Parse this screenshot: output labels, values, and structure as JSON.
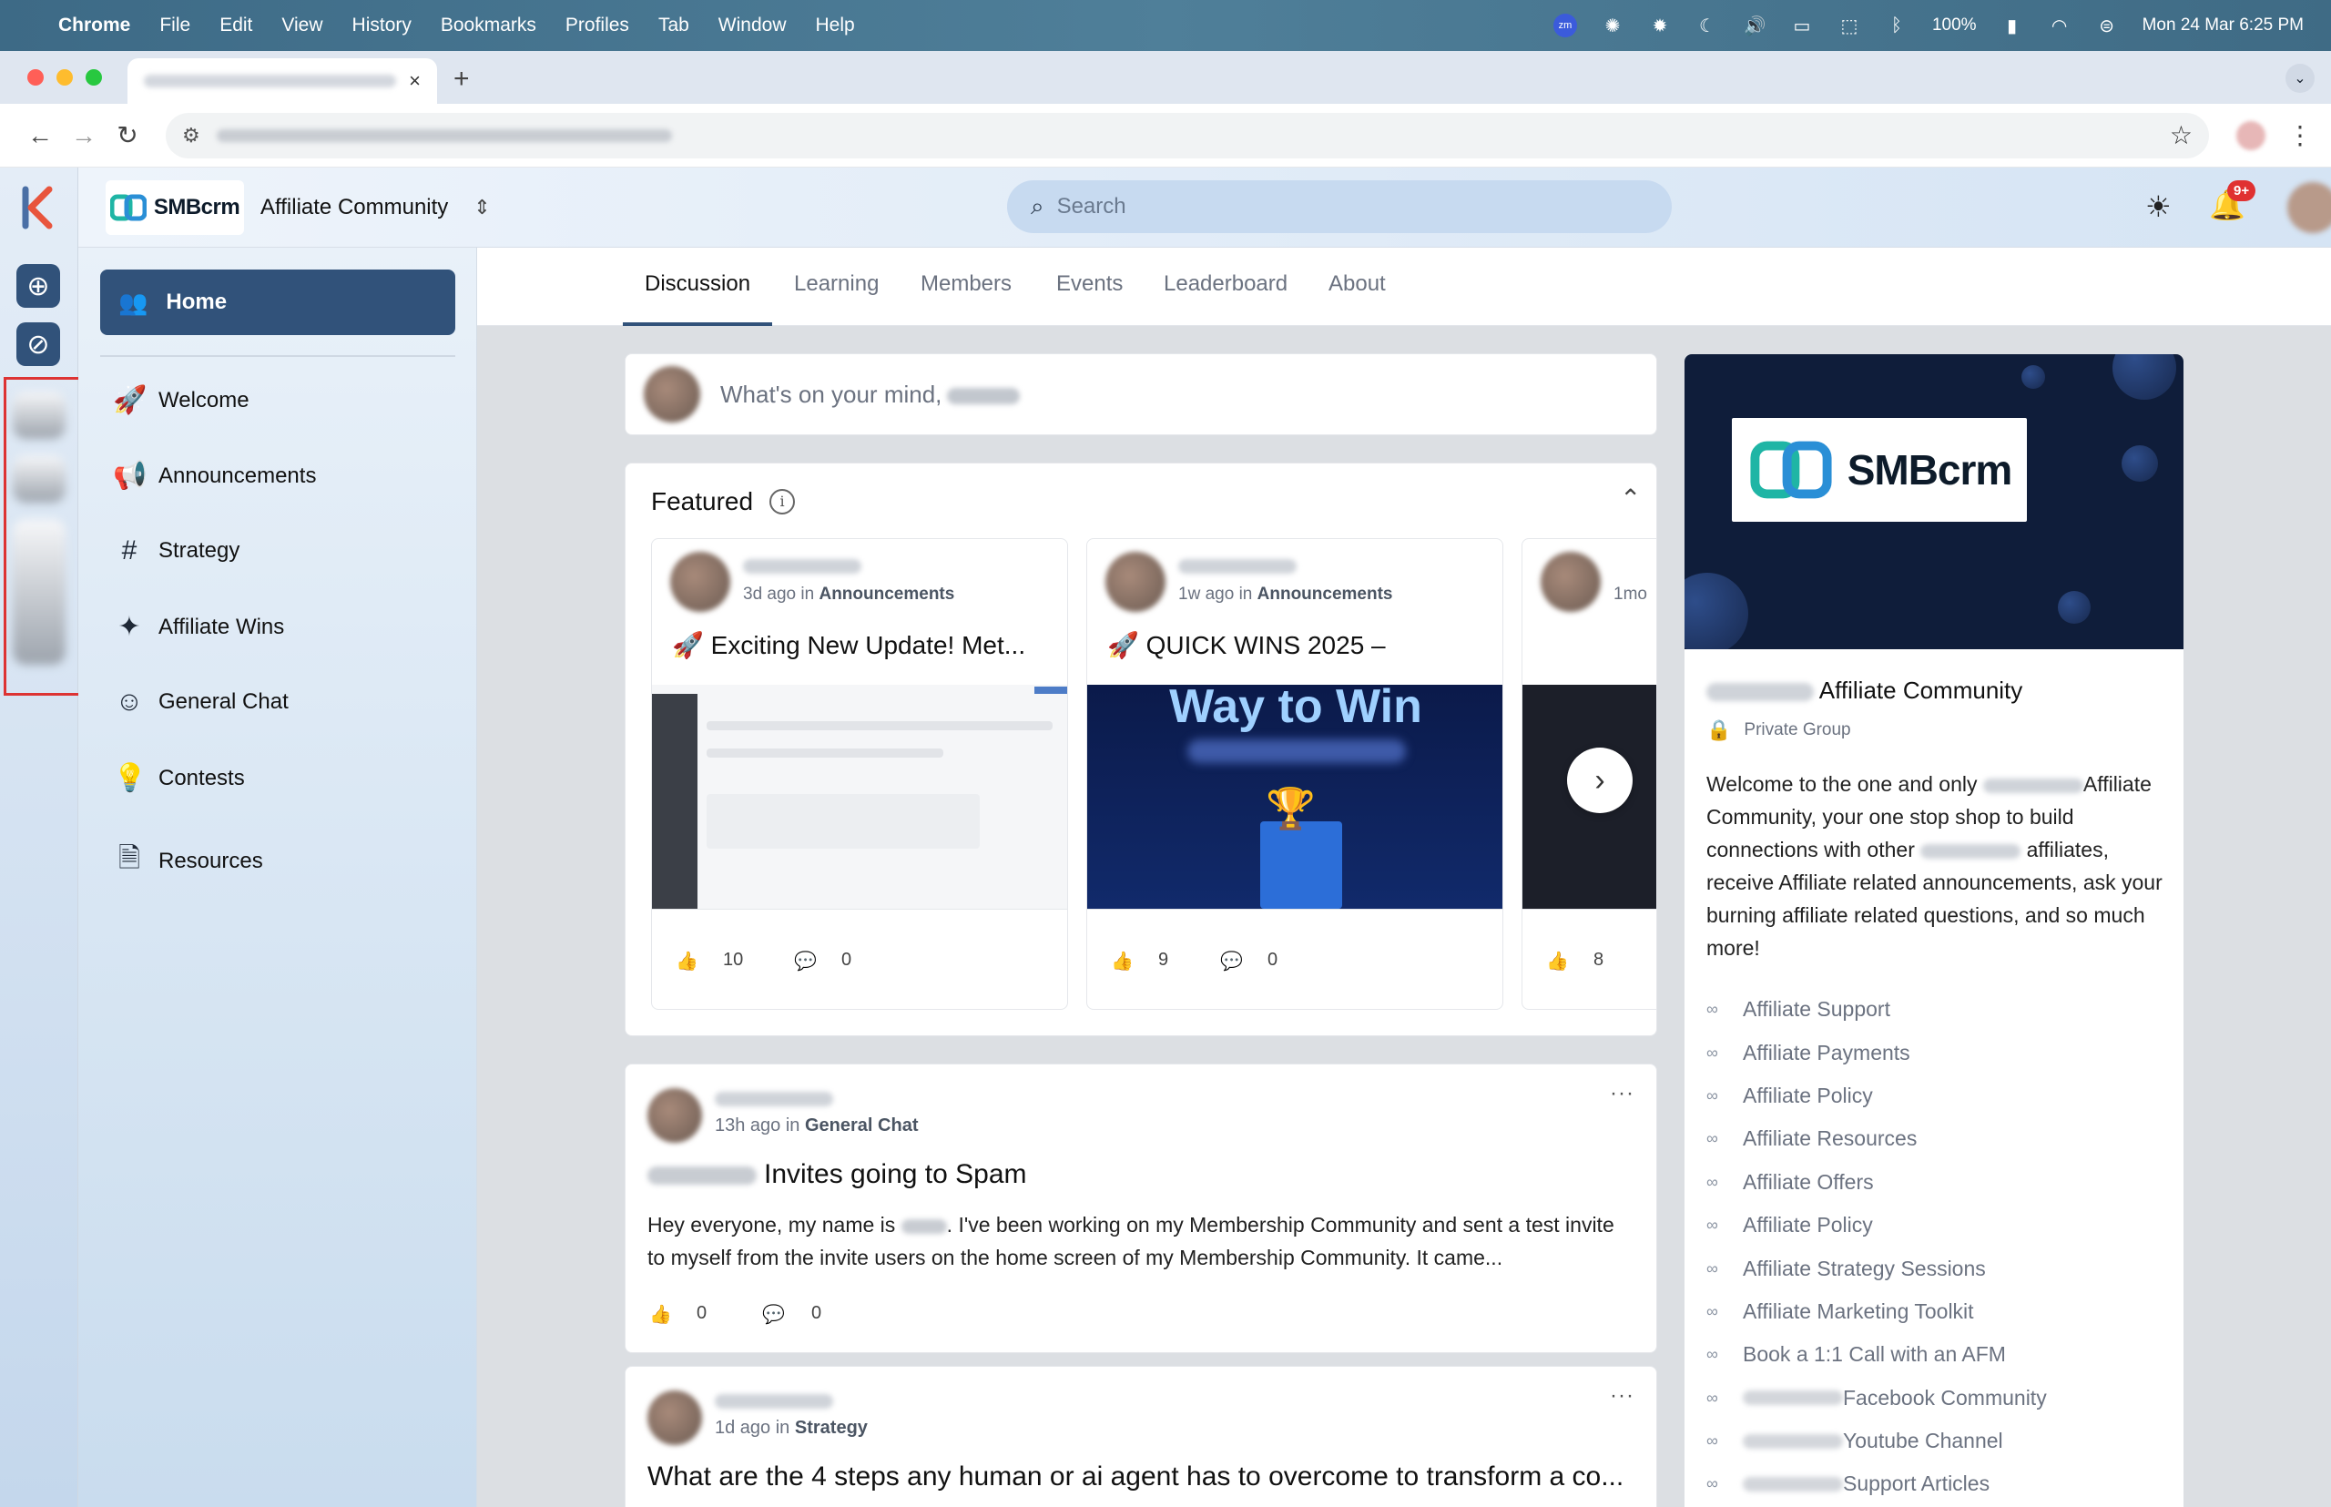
{
  "os_menubar": {
    "app": "Chrome",
    "items": [
      "File",
      "Edit",
      "View",
      "History",
      "Bookmarks",
      "Profiles",
      "Tab",
      "Window",
      "Help"
    ],
    "battery": "100%",
    "datetime": "Mon 24 Mar  6:25 PM",
    "zoom_label": "zm"
  },
  "browser": {
    "new_tab": "+",
    "close_tab": "×"
  },
  "header": {
    "brand": "SMBcrm",
    "community_title": "Affiliate Community",
    "search_placeholder": "Search",
    "notification_badge": "9+"
  },
  "sidebar": {
    "home_label": "Home",
    "items": [
      {
        "label": "Welcome",
        "icon": "rocket-icon"
      },
      {
        "label": "Announcements",
        "icon": "megaphone-icon"
      },
      {
        "label": "Strategy",
        "icon": "hash-icon"
      },
      {
        "label": "Affiliate Wins",
        "icon": "sparkle-icon"
      },
      {
        "label": "General Chat",
        "icon": "smile-icon"
      },
      {
        "label": "Contests",
        "icon": "lightbulb-icon"
      },
      {
        "label": "Resources",
        "icon": "document-icon"
      }
    ]
  },
  "tabs": [
    "Discussion",
    "Learning",
    "Members",
    "Events",
    "Leaderboard",
    "About"
  ],
  "composer": {
    "placeholder": "What's on your mind,"
  },
  "featured": {
    "title": "Featured",
    "cards": [
      {
        "time": "3d ago",
        "in": "in",
        "category": "Announcements",
        "title": "🚀 Exciting New Update! Met...",
        "likes": "10",
        "comments": "0"
      },
      {
        "time": "1w ago",
        "in": "in",
        "category": "Announcements",
        "title": "🚀 QUICK WINS 2025 –",
        "likes": "9",
        "comments": "0",
        "image_text": "Way to Win"
      },
      {
        "time": "1mo",
        "likes": "8"
      }
    ]
  },
  "posts": [
    {
      "time": "13h ago",
      "in": "in",
      "category": "General Chat",
      "title": "Invites going to Spam",
      "body_a": "Hey everyone, my name is",
      "body_b": ". I've been working on my Membership Community and sent a test invite to myself from the invite users on the home screen of my Membership Community. It came...",
      "likes": "0",
      "comments": "0"
    },
    {
      "time": "1d ago",
      "in": "in",
      "category": "Strategy",
      "title": "What are the 4 steps any human or ai agent has to overcome to transform a co..."
    }
  ],
  "about": {
    "brand": "SMBcrm",
    "title": "Affiliate Community",
    "privacy": "Private Group",
    "desc_a": "Welcome to the one and only",
    "desc_b": "Affiliate Community, your one stop shop to build connections with other",
    "desc_c": "affiliates, receive Affiliate related announcements, ask your burning affiliate related questions, and so much more!",
    "links": [
      {
        "label": "Affiliate Support"
      },
      {
        "label": "Affiliate Payments"
      },
      {
        "label": "Affiliate Policy"
      },
      {
        "label": "Affiliate Resources"
      },
      {
        "label": "Affiliate Offers"
      },
      {
        "label": "Affiliate Policy"
      },
      {
        "label": "Affiliate Strategy Sessions"
      },
      {
        "label": "Affiliate Marketing Toolkit"
      },
      {
        "label": "Book a 1:1 Call with an AFM"
      },
      {
        "label": "Facebook Community",
        "prefix_blurred": true
      },
      {
        "label": "Youtube Channel",
        "prefix_blurred": true
      },
      {
        "label": "Support Articles",
        "prefix_blurred": true
      }
    ]
  },
  "colors": {
    "accent": "#31527a",
    "banner": "#0f1d3a",
    "badge": "#e03131"
  }
}
